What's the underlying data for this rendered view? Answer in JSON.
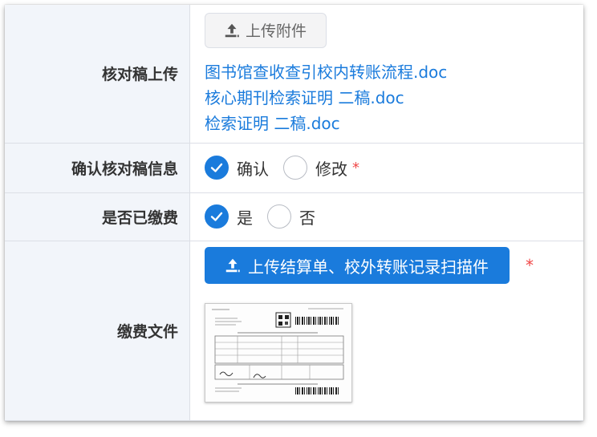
{
  "form": {
    "rows": [
      {
        "label": "核对稿上传",
        "upload_button": "上传附件",
        "files": [
          "图书馆查收查引校内转账流程.doc",
          "核心期刊检索证明 二稿.doc",
          "检索证明 二稿.doc"
        ]
      },
      {
        "label": "确认核对稿信息",
        "options": [
          "确认",
          "修改"
        ],
        "selected": "确认",
        "required_mark": "*"
      },
      {
        "label": "是否已缴费",
        "options": [
          "是",
          "否"
        ],
        "selected": "是"
      },
      {
        "label": "缴费文件",
        "upload_button": "上传结算单、校外转账记录扫描件",
        "required_mark": "*"
      }
    ]
  },
  "colors": {
    "accent": "#1a7bdc",
    "label_bg": "#f2f5fa",
    "required": "#f04848",
    "border": "#dcdfe6"
  },
  "icons": {
    "upload": "upload-icon",
    "check": "check-icon"
  }
}
